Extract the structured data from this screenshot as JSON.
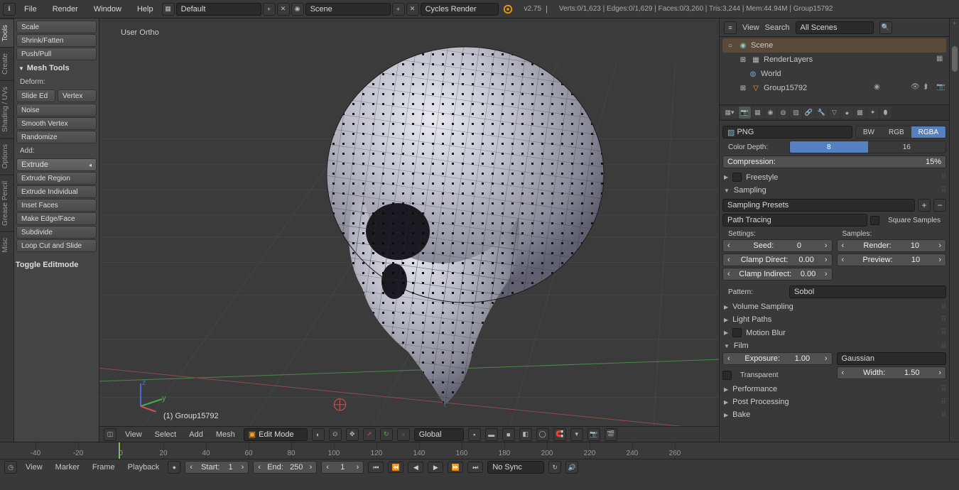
{
  "header": {
    "menus": [
      "File",
      "Render",
      "Window",
      "Help"
    ],
    "layout_dropdown": "Default",
    "scene_dropdown": "Scene",
    "engine_dropdown": "Cycles Render",
    "version": "v2.75",
    "stats": "Verts:0/1,623 | Edges:0/1,629 | Faces:0/3,260 | Tris:3,244 | Mem:44.94M | Group15792"
  },
  "vtabs": [
    "Tools",
    "Create",
    "Shading / UVs",
    "Options",
    "Grease Pencil",
    "Misc"
  ],
  "tools": {
    "top_buttons": [
      "Scale",
      "Shrink/Fatten",
      "Push/Pull"
    ],
    "mesh_tools_header": "Mesh Tools",
    "deform_label": "Deform:",
    "deform_split": [
      "Slide Ed",
      "Vertex"
    ],
    "deform_buttons": [
      "Noise",
      "Smooth Vertex",
      "Randomize"
    ],
    "add_label": "Add:",
    "add_buttons": [
      "Extrude",
      "Extrude Region",
      "Extrude Individual",
      "Inset Faces",
      "Make Edge/Face",
      "Subdivide",
      "Loop Cut and Slide"
    ],
    "toggle": "Toggle Editmode"
  },
  "viewport": {
    "top_label": "User Ortho",
    "object_label": "(1) Group15792"
  },
  "vp_footer": {
    "menus": [
      "View",
      "Select",
      "Add",
      "Mesh"
    ],
    "mode": "Edit Mode",
    "orient": "Global"
  },
  "outliner": {
    "menus": [
      "View",
      "Search"
    ],
    "filter": "All Scenes",
    "items": [
      {
        "label": "Scene",
        "icon": "scene"
      },
      {
        "label": "RenderLayers",
        "icon": "layers"
      },
      {
        "label": "World",
        "icon": "world"
      },
      {
        "label": "Group15792",
        "icon": "mesh"
      }
    ]
  },
  "props": {
    "format_dropdown": "PNG",
    "bw": "BW",
    "rgb": "RGB",
    "rgba": "RGBA",
    "color_depth_label": "Color Depth:",
    "depth_8": "8",
    "depth_16": "16",
    "compression_label": "Compression:",
    "compression_val": "15%",
    "freestyle": "Freestyle",
    "sampling": "Sampling",
    "sampling_presets": "Sampling Presets",
    "integrator": "Path Tracing",
    "square_samples": "Square Samples",
    "settings_label": "Settings:",
    "samples_label": "Samples:",
    "seed_label": "Seed:",
    "seed_val": "0",
    "clamp_direct_label": "Clamp Direct:",
    "clamp_direct_val": "0.00",
    "clamp_indirect_label": "Clamp Indirect:",
    "clamp_indirect_val": "0.00",
    "render_label": "Render:",
    "render_val": "10",
    "preview_label": "Preview:",
    "preview_val": "10",
    "pattern_label": "Pattern:",
    "pattern_val": "Sobol",
    "volume_sampling": "Volume Sampling",
    "light_paths": "Light Paths",
    "motion_blur": "Motion Blur",
    "film": "Film",
    "exposure_label": "Exposure:",
    "exposure_val": "1.00",
    "gaussian": "Gaussian",
    "width_label": "Width:",
    "width_val": "1.50",
    "transparent": "Transparent",
    "performance": "Performance",
    "post_processing": "Post Processing",
    "bake": "Bake"
  },
  "timeline": {
    "menus": [
      "View",
      "Marker",
      "Frame",
      "Playback"
    ],
    "start_label": "Start:",
    "start_val": "1",
    "end_label": "End:",
    "end_val": "250",
    "current": "1",
    "sync": "No Sync",
    "ticks": [
      -40,
      -20,
      0,
      20,
      40,
      60,
      80,
      100,
      120,
      140,
      160,
      180,
      200,
      220,
      240,
      260
    ]
  }
}
